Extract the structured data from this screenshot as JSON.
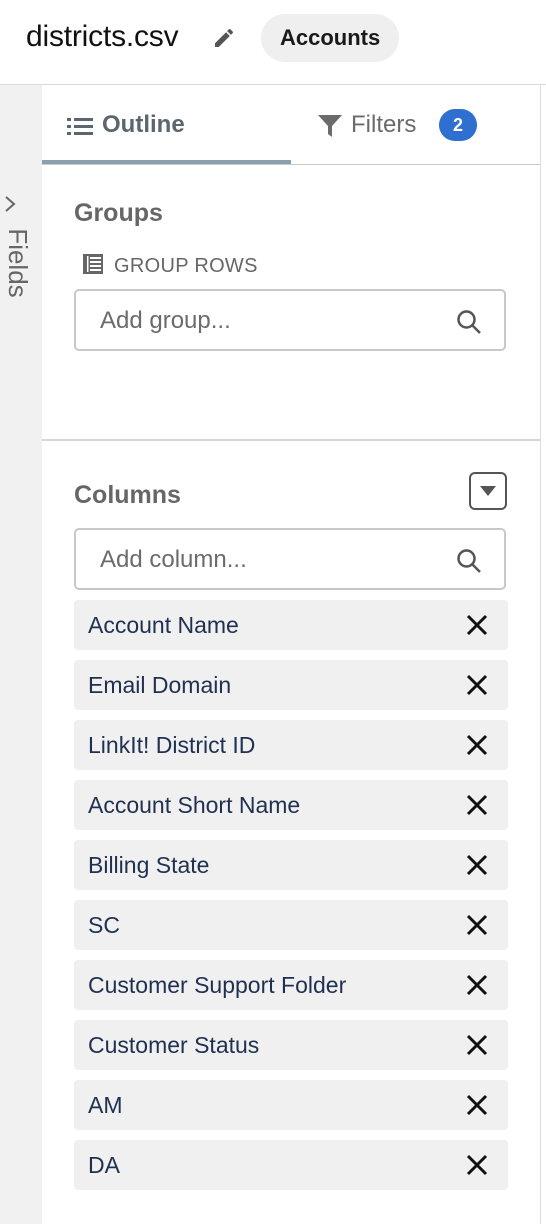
{
  "header": {
    "file_name": "districts.csv",
    "object_badge": "Accounts"
  },
  "sidebar": {
    "label": "Fields"
  },
  "tabs": {
    "outline": "Outline",
    "filters": "Filters",
    "filters_count": "2"
  },
  "groups": {
    "title": "Groups",
    "sub_label": "GROUP ROWS",
    "placeholder": "Add group..."
  },
  "columns": {
    "title": "Columns",
    "placeholder": "Add column...",
    "items": [
      "Account Name",
      "Email Domain",
      "LinkIt! District ID",
      "Account Short Name",
      "Billing State",
      "SC",
      "Customer Support Folder",
      "Customer Status",
      "AM",
      "DA"
    ]
  },
  "colors": {
    "accent_blue": "#2f6fd0",
    "tab_underline": "#8aa1ad",
    "column_text": "#1f3050"
  },
  "icons": [
    "pencil-icon",
    "chevron-right-icon",
    "list-icon",
    "filter-icon",
    "table-icon",
    "search-icon",
    "caret-down-icon",
    "close-icon"
  ]
}
